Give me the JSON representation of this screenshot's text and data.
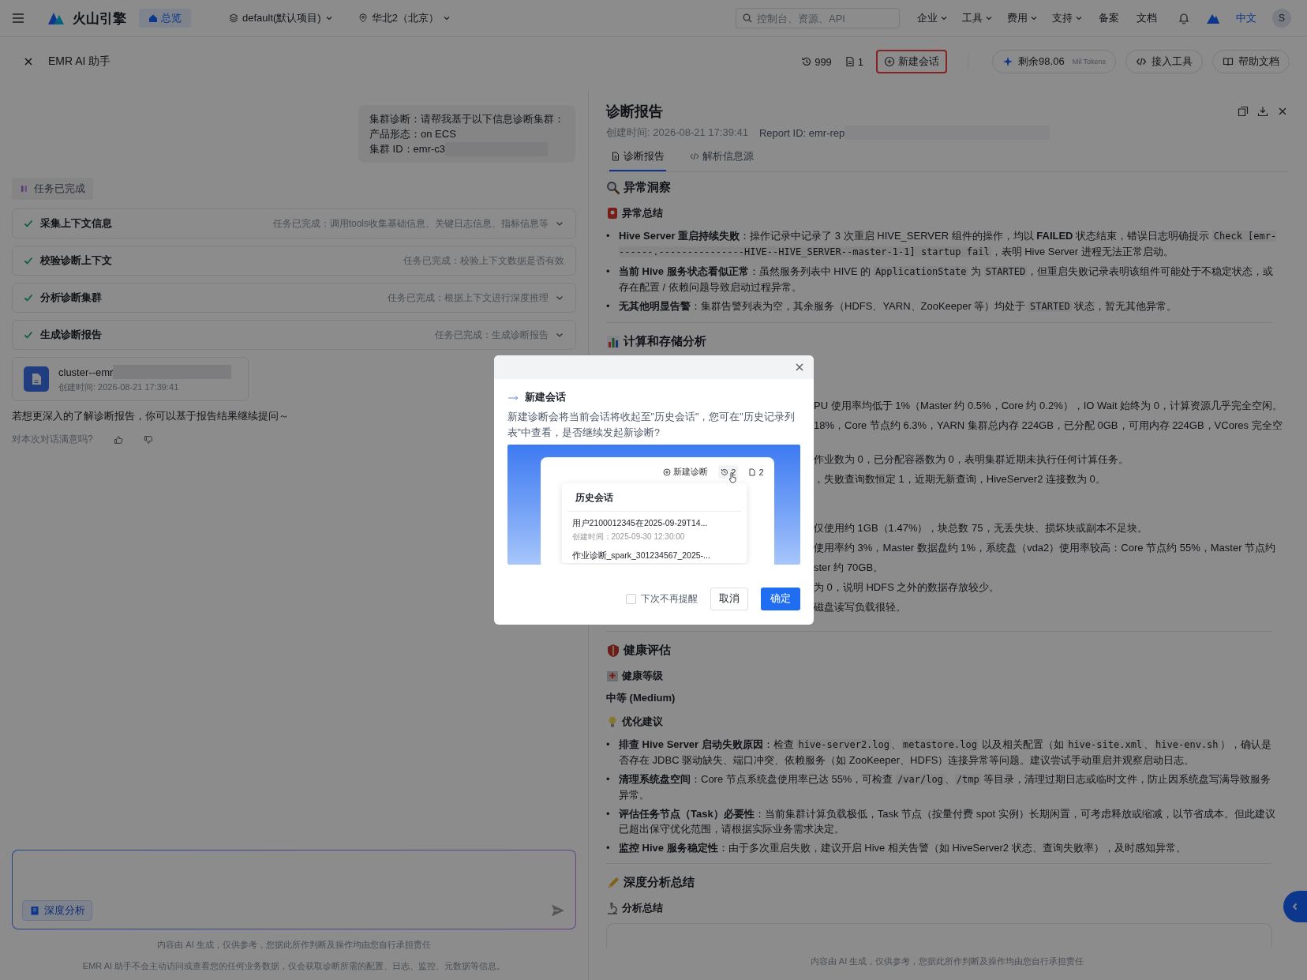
{
  "top_nav": {
    "brand": "火山引擎",
    "home_tab": "总览",
    "project": "default(默认项目)",
    "region": "华北2（北京）",
    "search": {
      "placeholder": "控制台、资源、API"
    },
    "menus": [
      "企业",
      "工具",
      "费用",
      "支持"
    ],
    "links": [
      "备案",
      "文档"
    ],
    "language": {
      "label": "中文",
      "selected": true
    },
    "avatar": "S"
  },
  "header": {
    "title": "EMR AI 助手",
    "history_count": "999",
    "report_count": "1",
    "new_chat": {
      "label": "新建会话",
      "highlighted": true
    },
    "tokens": {
      "value": "剩余98.06",
      "unit": "Mil Tokens"
    },
    "actions": [
      "接入工具",
      "帮助文档"
    ]
  },
  "chat": {
    "user_message": [
      "集群诊断：请帮我基于以下信息诊断集群：",
      "产品形态：on ECS",
      "集群 ID：emr-c3"
    ],
    "status": "任务已完成",
    "steps": [
      {
        "title": "采集上下文信息",
        "summary": "任务已完成：调用tools收集基础信息、关键日志信息、指标信息等",
        "done": true,
        "expandable": true
      },
      {
        "title": "校验诊断上下文",
        "summary": "任务已完成：校验上下文数据是否有效",
        "done": true,
        "expandable": false
      },
      {
        "title": "分析诊断集群",
        "summary": "任务已完成：根据上下文进行深度推理",
        "done": true,
        "expandable": true
      },
      {
        "title": "生成诊断报告",
        "summary": "任务已完成：生成诊断报告",
        "done": true,
        "expandable": true
      }
    ],
    "report_card": {
      "name": "cluster--emr",
      "created": "创建时间: 2026-08-21 17:39:41"
    },
    "follow_up": "若想更深入的了解诊断报告，你可以基于报告结果继续提问～",
    "feedback_prompt": "对本次对话满意吗?",
    "composer": {
      "mode": "深度分析"
    },
    "disclaimers": [
      "内容由 AI 生成，仅供参考，您据此所作判断及操作均由您自行承担责任",
      "EMR AI 助手不会主动访问或查看您的任何业务数据，仅会获取诊断所需的配置、日志、监控、元数据等信息。"
    ]
  },
  "report": {
    "title": "诊断报告",
    "created": "创建时间: 2026-08-21 17:39:41",
    "report_id": "Report ID: emr-rep",
    "tabs": [
      {
        "label": "诊断报告",
        "selected": true
      },
      {
        "label": "解析信息源",
        "selected": false
      }
    ],
    "blocks": [
      {
        "kind": "heading",
        "text": "异常洞察"
      },
      {
        "kind": "subheading",
        "text": "异常总结"
      },
      {
        "kind": "bullets",
        "marker": "•",
        "items": [
          [
            {
              "kind": "bold",
              "text": "Hive Server 重启持续失败"
            },
            {
              "kind": "plain",
              "text": "：操作记录中记录了 3 次重启 HIVE_SERVER 组件的操作，均以 "
            },
            {
              "kind": "bold",
              "text": "FAILED"
            },
            {
              "kind": "plain",
              "text": " 状态结束，错误日志明确提示 "
            },
            {
              "kind": "code",
              "text": "Check [emr-------.---------------HIVE--HIVE_SERVER--master-1-1] startup fail"
            },
            {
              "kind": "plain",
              "text": "，表明 Hive Server 进程无法正常启动。"
            }
          ],
          [
            {
              "kind": "bold",
              "text": "当前 Hive 服务状态看似正常"
            },
            {
              "kind": "plain",
              "text": "：虽然服务列表中 HIVE 的 "
            },
            {
              "kind": "code",
              "text": "ApplicationState"
            },
            {
              "kind": "plain",
              "text": " 为 "
            },
            {
              "kind": "code",
              "text": "STARTED"
            },
            {
              "kind": "plain",
              "text": "，但重启失败记录表明该组件可能处于不稳定状态，或存在配置 / 依赖问题导致启动过程异常。"
            }
          ],
          [
            {
              "kind": "bold",
              "text": "无其他明显告警"
            },
            {
              "kind": "plain",
              "text": "：集群告警列表为空，其余服务（HDFS、YARN、ZooKeeper 等）均处于 "
            },
            {
              "kind": "code",
              "text": "STARTED"
            },
            {
              "kind": "plain",
              "text": " 状态，暂无其他异常。"
            }
          ]
        ]
      },
      {
        "kind": "divider"
      },
      {
        "kind": "heading",
        "text": "计算和存储分析"
      },
      {
        "kind": "occluded",
        "groups": [
          [
            "PU 使用率均低于 1%（Master 约 0.5%，Core 约 0.2%），IO Wait 始终为 0，计算资源几乎完全空闲。",
            "18%，Core 节点约 6.3%，YARN 集群总内存 224GB，已分配 0GB，可用内存 224GB，VCores 完全空"
          ],
          [
            "作业数为 0，已分配容器数为 0，表明集群近期未执行任何计算任务。",
            "，失败查询数恒定 1，近期无新查询，HiveServer2 连接数为 0。"
          ],
          [
            "仅使用约 1GB（1.47%），块总数 75，无丢失块、损坏块或副本不足块。",
            "使用率约 3%，Master 数据盘约 1%，系统盘（vda2）使用率较高：Core 节点约 55%，Master 节点约",
            "ster 约 70GB。",
            "为 0，说明 HDFS 之外的数据存放较少。",
            "磁盘读写负载很轻。"
          ]
        ]
      },
      {
        "kind": "divider"
      },
      {
        "kind": "heading",
        "text": "健康评估"
      },
      {
        "kind": "subheading",
        "text": "健康等级"
      },
      {
        "kind": "rating",
        "text": "中等 (Medium)"
      },
      {
        "kind": "subheading",
        "text": "优化建议"
      },
      {
        "kind": "bullets",
        "marker": "•",
        "items": [
          [
            {
              "kind": "bold",
              "text": "排查 Hive Server 启动失败原因"
            },
            {
              "kind": "plain",
              "text": "：检查 "
            },
            {
              "kind": "code",
              "text": "hive-server2.log"
            },
            {
              "kind": "plain",
              "text": "、"
            },
            {
              "kind": "code",
              "text": "metastore.log"
            },
            {
              "kind": "plain",
              "text": " 以及相关配置（如 "
            },
            {
              "kind": "code",
              "text": "hive-site.xml"
            },
            {
              "kind": "plain",
              "text": "、"
            },
            {
              "kind": "code",
              "text": "hive-env.sh"
            },
            {
              "kind": "plain",
              "text": "），确认是否存在 JDBC 驱动缺失、端口冲突、依赖服务（如 ZooKeeper、HDFS）连接异常等问题。建议尝试手动重启并观察启动日志。"
            }
          ],
          [
            {
              "kind": "bold",
              "text": "清理系统盘空间"
            },
            {
              "kind": "plain",
              "text": "：Core 节点系统盘使用率已达 55%，可检查 "
            },
            {
              "kind": "code",
              "text": "/var/log"
            },
            {
              "kind": "plain",
              "text": "、"
            },
            {
              "kind": "code",
              "text": "/tmp"
            },
            {
              "kind": "plain",
              "text": " 等目录，清理过期日志或临时文件，防止因系统盘写满导致服务异常。"
            }
          ],
          [
            {
              "kind": "bold",
              "text": "评估任务节点（Task）必要性"
            },
            {
              "kind": "plain",
              "text": "：当前集群计算负载极低，Task 节点（按量付费 spot 实例）长期闲置，可考虑释放或缩减，以节省成本。但此建议已超出保守优化范围，请根据实际业务需求决定。"
            }
          ],
          [
            {
              "kind": "bold",
              "text": "监控 Hive 服务稳定性"
            },
            {
              "kind": "plain",
              "text": "：由于多次重启失败，建议开启 Hive 相关告警（如 HiveServer2 状态、查询失败率），及时感知异常。"
            }
          ]
        ]
      },
      {
        "kind": "divider"
      },
      {
        "kind": "heading",
        "text": "深度分析总结"
      },
      {
        "kind": "subheading",
        "text": "分析总结"
      }
    ],
    "footer": "内容由 AI 生成，仅供参考，您据此所作判断及操作均由您自行承担责任"
  },
  "dialog": {
    "title": "新建会话",
    "message": "新建诊断会将当前会话将收起至\"历史会话\"，您可在\"历史记录列表\"中查看，是否继续发起新诊断?",
    "preview": {
      "new_button": "新建诊断",
      "history_count": "2",
      "report_count": "2",
      "panel_title": "历史会话",
      "items": [
        {
          "title": "用户2100012345在2025-09-29T14...",
          "time": "创建时间：2025-09-30 12:30:00"
        },
        {
          "title": "作业诊断_spark_301234567_2025-..."
        }
      ]
    },
    "dont_remind": {
      "label": "下次不再提醒",
      "checked": false
    },
    "cancel": "取消",
    "confirm": "确定"
  }
}
